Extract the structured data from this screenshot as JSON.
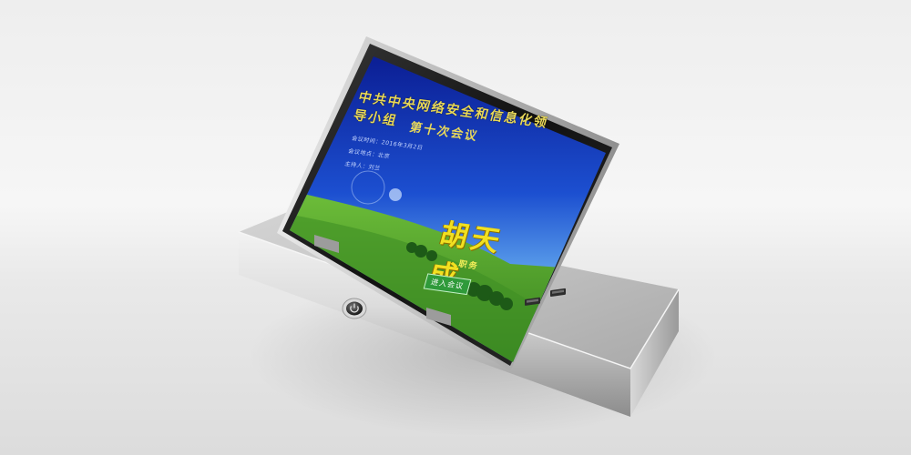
{
  "screen": {
    "title": "中共中央网络安全和信息化领导小组",
    "subtitle": "第十次会议",
    "meta_lines": [
      "会议时间：2016年3月2日",
      "会议地点：北京",
      "主持人：刘兰"
    ],
    "name": "胡天成",
    "role": "职务",
    "enter_button": "进入会议"
  },
  "colors": {
    "sky_top": "#0b1f9c",
    "sky_mid": "#1b5ad6",
    "grass": "#4c9a2a",
    "base_silver": "#b8b8b8",
    "title_text": "#e8d85a",
    "nameplate_text": "#f1e021",
    "button_green": "#2f9a3a"
  },
  "icons": {
    "power": "power-icon",
    "usb": "usb-port-icon"
  }
}
